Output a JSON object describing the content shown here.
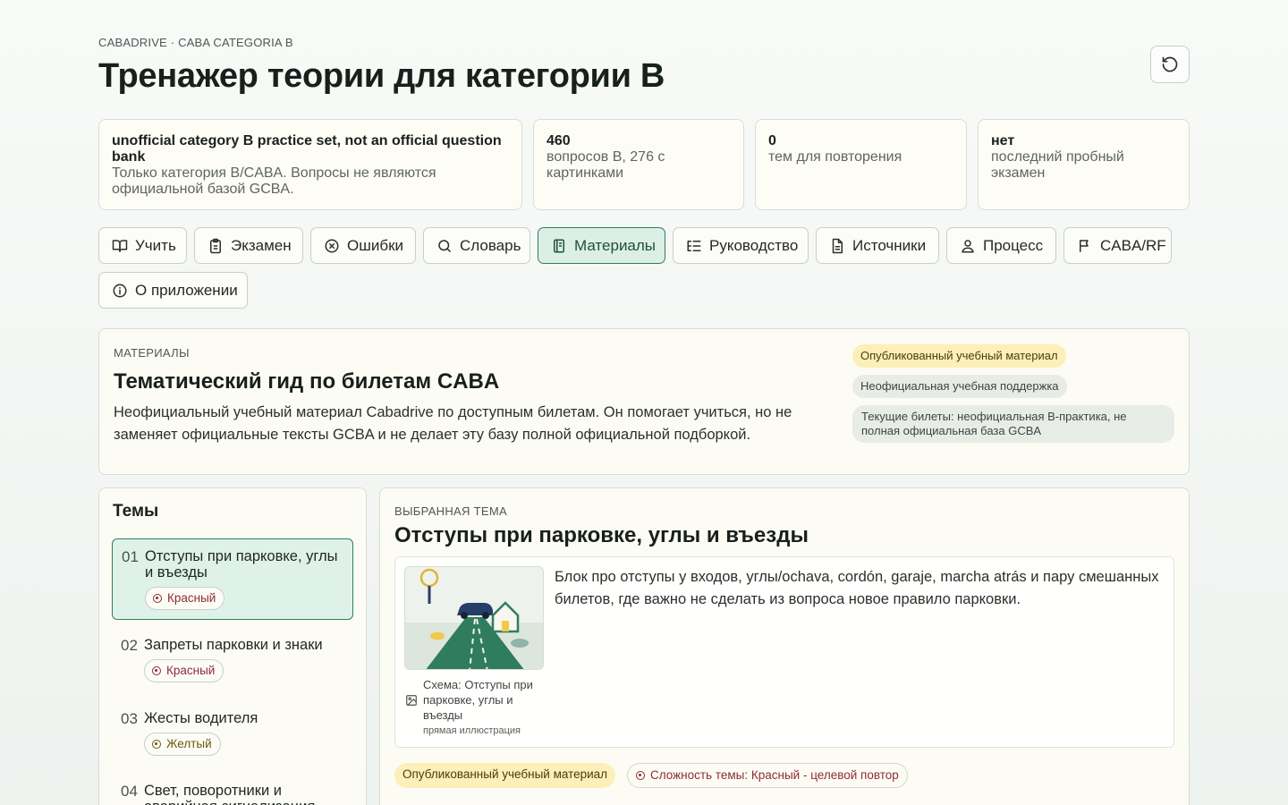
{
  "header": {
    "eyebrow": "CABADRIVE · CABA CATEGORIA B",
    "title": "Тренажер теории для категории B"
  },
  "stats": [
    {
      "title": "unofficial category B practice set, not an official question bank",
      "sub": "Только категория B/CABA. Вопросы не являются официальной базой GCBA."
    },
    {
      "title": "460",
      "sub": "вопросов B, 276 с картинками"
    },
    {
      "title": "0",
      "sub": "тем для повторения"
    },
    {
      "title": "нет",
      "sub": "последний пробный экзамен"
    }
  ],
  "nav": [
    {
      "label": "Учить",
      "icon": "book-open-icon"
    },
    {
      "label": "Экзамен",
      "icon": "clipboard-icon"
    },
    {
      "label": "Ошибки",
      "icon": "x-circle-icon"
    },
    {
      "label": "Словарь",
      "icon": "search-icon"
    },
    {
      "label": "Материалы",
      "icon": "notebook-icon"
    },
    {
      "label": "Руководство",
      "icon": "list-tree-icon"
    },
    {
      "label": "Источники",
      "icon": "file-text-icon"
    },
    {
      "label": "Процесс",
      "icon": "user-check-icon"
    },
    {
      "label": "CABA/RF",
      "icon": "flag-icon"
    },
    {
      "label": "О приложении",
      "icon": "info-icon"
    }
  ],
  "nav_active": "Материалы",
  "materials": {
    "eyebrow": "МАТЕРИАЛЫ",
    "title": "Тематический гид по билетам CABA",
    "description": "Неофициальный учебный материал Cabadrive по доступным билетам. Он помогает учиться, но не заменяет официальные тексты GCBA и не делает эту базу полной официальной подборкой.",
    "badges": [
      "Опубликованный учебный материал",
      "Неофициальная учебная поддержка",
      "Текущие билеты: неофициальная B-практика, не полная официальная база GCBA"
    ]
  },
  "topics_panel": {
    "title": "Темы",
    "items": [
      {
        "num": "01",
        "name": "Отступы при парковке, углы и въезды",
        "tag": "Красный",
        "level": "red"
      },
      {
        "num": "02",
        "name": "Запреты парковки и знаки",
        "tag": "Красный",
        "level": "red"
      },
      {
        "num": "03",
        "name": "Жесты водителя",
        "tag": "Желтый",
        "level": "yellow"
      },
      {
        "num": "04",
        "name": "Свет, поворотники и аварийная сигнализация",
        "tag": "",
        "level": ""
      }
    ]
  },
  "selected": {
    "eyebrow": "ВЫБРАННАЯ ТЕМА",
    "title": "Отступы при парковке, углы и въезды",
    "description": "Блок про отступы у входов, углы/ochava, cordón, garaje, marcha atrás и пару смешанных билетов, где важно не сделать из вопроса новое правило парковки.",
    "image_caption": "Схема: Отступы при парковке, углы и въезды",
    "image_note": "прямая иллюстрация",
    "badge_published": "Опубликованный учебный материал",
    "badge_difficulty": "Сложность темы: Красный - целевой повтор"
  },
  "colors": {
    "accent": "#2f7d5e",
    "red": "#8d2c33",
    "yellow_bg": "#fcefb8"
  }
}
